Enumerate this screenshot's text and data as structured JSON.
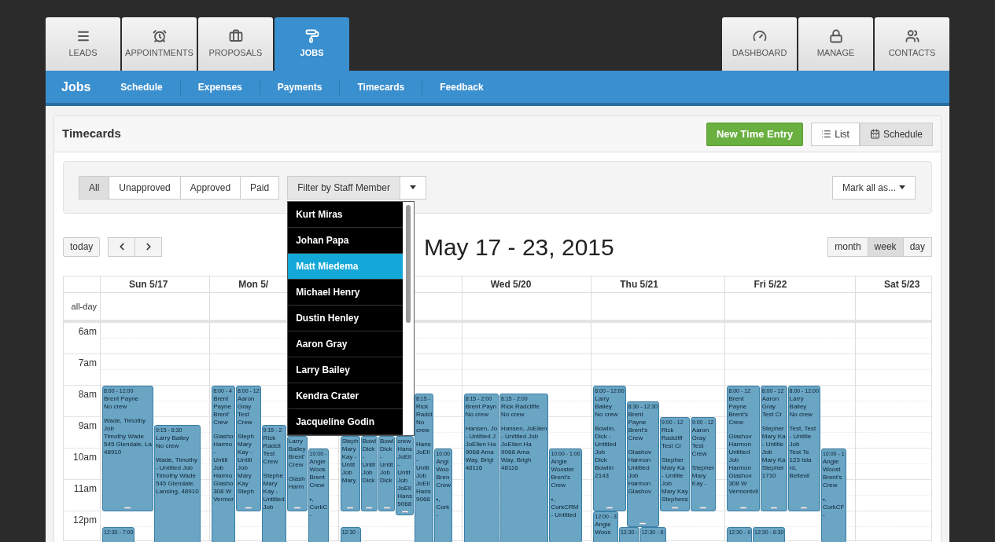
{
  "tabs_left": [
    {
      "label": "LEADS",
      "selected": false
    },
    {
      "label": "APPOINTMENTS",
      "selected": false
    },
    {
      "label": "PROPOSALS",
      "selected": false
    },
    {
      "label": "JOBS",
      "selected": true
    }
  ],
  "tabs_right": [
    {
      "label": "DASHBOARD",
      "selected": false
    },
    {
      "label": "MANAGE",
      "selected": false
    },
    {
      "label": "CONTACTS",
      "selected": false
    }
  ],
  "subnav": {
    "title": "Jobs",
    "links": [
      "Schedule",
      "Expenses",
      "Payments",
      "Timecards",
      "Feedback"
    ]
  },
  "panel": {
    "title": "Timecards",
    "new_button": "New Time Entry",
    "views": [
      {
        "label": "List",
        "selected": false
      },
      {
        "label": "Schedule",
        "selected": true
      }
    ]
  },
  "filters": {
    "status": [
      {
        "label": "All",
        "selected": true
      },
      {
        "label": "Unapproved",
        "selected": false
      },
      {
        "label": "Approved",
        "selected": false
      },
      {
        "label": "Paid",
        "selected": false
      }
    ],
    "staff_filter": "Filter by Staff Member",
    "mark_all": "Mark all as...",
    "staff_menu": [
      {
        "label": "Kurt Miras",
        "selected": false
      },
      {
        "label": "Johan Papa",
        "selected": false
      },
      {
        "label": "Matt Miedema",
        "selected": true
      },
      {
        "label": "Michael Henry",
        "selected": false
      },
      {
        "label": "Dustin Henley",
        "selected": false
      },
      {
        "label": "Aaron Gray",
        "selected": false
      },
      {
        "label": "Larry Bailey",
        "selected": false
      },
      {
        "label": "Kendra Crater",
        "selected": false
      },
      {
        "label": "Jacqueline Godin",
        "selected": false
      }
    ]
  },
  "calendar": {
    "today": "today",
    "title": "May 17 - 23, 2015",
    "ranges": [
      {
        "label": "month",
        "selected": false
      },
      {
        "label": "week",
        "selected": true
      },
      {
        "label": "day",
        "selected": false
      }
    ],
    "all_day": "all-day",
    "hours": [
      "6am",
      "7am",
      "8am",
      "9am",
      "10am",
      "11am",
      "12pm"
    ],
    "days": [
      {
        "label": "Sun 5/17",
        "groups": [
          {
            "events": [
              {
                "time": "8:00 - 12:00",
                "head": [
                  "Brent Payne",
                  "No crew"
                ],
                "body": [
                  "Wade, Timothy",
                  "Job",
                  "Timothy Wade",
                  "545 Glendale, La",
                  "48910"
                ]
              },
              {
                "time": "9:15 - 6:30",
                "head": [
                  "Larry Bailey",
                  "No crew"
                ],
                "body": [
                  "Wade, Timothy",
                  "- Untitled Job",
                  "Timothy Wade",
                  "545 Glendale,",
                  "Lansing, 48910"
                ]
              }
            ]
          },
          {
            "events": [
              {
                "time": "12:30 - 7:00"
              }
            ]
          }
        ]
      },
      {
        "label": "Mon 5/",
        "groups": [
          {
            "events": [
              {
                "time": "8:00 - 4",
                "head": [
                  "Brent",
                  "Payne",
                  "Brent'",
                  "Crew"
                ],
                "body": [
                  "Glasho",
                  "Harmo",
                  "-",
                  "Untitl",
                  "Job",
                  "Harmo",
                  "Glasho",
                  "308 W",
                  "Vermor"
                ]
              },
              {
                "time": "8:00 - 12",
                "head": [
                  "Aaron",
                  "Gray",
                  "Test",
                  "Crew"
                ],
                "body": [
                  "Steph",
                  "Mary",
                  "Kay -",
                  "Untitl",
                  "Job",
                  "Mary",
                  "Kay",
                  "Steph"
                ]
              },
              {
                "time": "9:15 - 2",
                "head": [
                  "Rick",
                  "Radcli",
                  "Test",
                  "Crew"
                ],
                "body": [
                  "Stephe",
                  "Mary",
                  "Kay -",
                  "Untitled",
                  "Job"
                ]
              },
              {
                "head": [
                  "Larry",
                  "Bailey",
                  "Brent'",
                  "Crew"
                ],
                "body": [
                  "Glash",
                  "Harm"
                ]
              },
              {
                "time": "10:00 -",
                "head": [
                  "Angie",
                  "Woos",
                  "Brent",
                  "Crew"
                ],
                "body": [
                  "•,",
                  "CorkC",
                  "-"
                ]
              }
            ]
          }
        ]
      },
      {
        "groups": [
          {
            "events": [
              {
                "body": [
                  "Steph",
                  "Mary",
                  "Kay -",
                  "Untit",
                  "Job",
                  "Mary"
                ]
              },
              {
                "body": [
                  "Bowl",
                  "Dick",
                  "-",
                  "Untit",
                  "Job",
                  "Dick"
                ]
              },
              {
                "body": [
                  "Bowl",
                  "Dick",
                  "-",
                  "Untit",
                  "Job",
                  "Dick"
                ]
              },
              {
                "body": [
                  "crew",
                  "Hans",
                  "JoEll",
                  "-",
                  "Untit",
                  "Job",
                  "JoEll",
                  "Hans",
                  "9068"
                ]
              },
              {
                "time": "8:15 -",
                "head": [
                  "Rick",
                  "Radcl",
                  "No",
                  "crew"
                ],
                "body": [
                  "Hans",
                  "JoEll",
                  "-",
                  "Untit",
                  "Job",
                  "JoEll",
                  "Hans",
                  "9068"
                ]
              },
              {
                "time": "10:00",
                "head": [
                  "Angi",
                  "Woo",
                  "Bren",
                  "Crew"
                ],
                "body": [
                  "•,",
                  "Cork",
                  "-"
                ]
              }
            ]
          },
          {
            "events": [
              {
                "time": "12:30 -"
              }
            ]
          }
        ]
      },
      {
        "label": "Wed 5/20",
        "groups": [
          {
            "events": [
              {
                "time": "8:15 - 2:00",
                "head": [
                  "Brent Payn",
                  "No crew"
                ],
                "body": [
                  "Hansen, Jo",
                  "- Untitled J",
                  "JoEllen Ha",
                  "9068 Ama",
                  "Way, Brigl",
                  "48116"
                ]
              },
              {
                "time": "8:15 - 2:00",
                "head": [
                  "Rick Radcliffe",
                  "No crew"
                ],
                "body": [
                  "Hansen, JoEllen",
                  "- Untitled Job",
                  "JoEllen Ha",
                  "9068 Ama",
                  "Way, Brigh",
                  "48116"
                ]
              },
              {
                "time": "10:00 - 1:00",
                "head": [
                  "Angie",
                  "Wooster",
                  "Brent's",
                  "Crew"
                ],
                "body": [
                  "•,",
                  "CorkCRM",
                  "- Untitled"
                ]
              }
            ]
          }
        ]
      },
      {
        "label": "Thu 5/21",
        "groups": [
          {
            "events": [
              {
                "time": "8:00 - 12:00",
                "head": [
                  "Larry",
                  "Bailey",
                  "No crew"
                ],
                "body": [
                  "Bowlin,",
                  "Dick -",
                  "Untitled",
                  "Job",
                  "Dick",
                  "Bowlin",
                  "2143"
                ]
              },
              {
                "time": "8:30 - 12:30",
                "head": [
                  "Brent",
                  "Payne",
                  "Brent's",
                  "Crew"
                ],
                "body": [
                  "Glashov",
                  "Harmon",
                  "Untitled",
                  "Job",
                  "Harmon",
                  "Glashov"
                ]
              },
              {
                "time": "9:00 - 12",
                "head": [
                  "Rick",
                  "Radcliff",
                  "Test Cr"
                ],
                "body": [
                  "Stepher",
                  "Mary Ka",
                  "- Untitle",
                  "Job",
                  "Mary Kay",
                  "Stephens"
                ]
              },
              {
                "time": "9:00 - 12",
                "head": [
                  "Aaron",
                  "Gray",
                  "Test",
                  "Crew"
                ],
                "body": [
                  "Stepher",
                  "Mary",
                  "Kay -"
                ]
              }
            ]
          },
          {
            "events": [
              {
                "time": "12:00 - 3",
                "head": [
                  "Angie",
                  "Woos"
                ]
              },
              {
                "time": "12:30 -"
              },
              {
                "time": "12:30 - 6:"
              }
            ]
          }
        ]
      },
      {
        "label": "Fri 5/22",
        "groups": [
          {
            "events": [
              {
                "time": "8:00 - 12",
                "head": [
                  "Brent",
                  "Payne",
                  "Brent's",
                  "Crew"
                ],
                "body": [
                  "Glashov",
                  "Harmon",
                  "Untitled",
                  "Job",
                  "Harmon",
                  "Glashov",
                  "308 W",
                  "Vermontvil"
                ]
              },
              {
                "time": "8:00 - 12",
                "head": [
                  "Aaron",
                  "Gray",
                  "Test Cr"
                ],
                "body": [
                  "Stepher",
                  "Mary Ka",
                  "- Untitle",
                  "Job",
                  "Mary Ka",
                  "Stepher",
                  "1710"
                ]
              },
              {
                "time": "8:00 - 12:00",
                "head": [
                  "Larry",
                  "Bailey",
                  "No crew"
                ],
                "body": [
                  "Test, Test",
                  "- Untitle",
                  "Job",
                  "Test Te",
                  "123 Isla",
                  "rd,",
                  "Bellevil"
                ]
              },
              {
                "time": "10:00 - 1",
                "head": [
                  "Angie",
                  "Woost",
                  "Brent's",
                  "Crew"
                ],
                "body": [
                  "•,",
                  "CorkCF",
                  "-"
                ]
              }
            ]
          },
          {
            "events": [
              {
                "time": "12:30 - 9"
              },
              {
                "time": "12:30 - 6:30"
              }
            ]
          }
        ]
      },
      {
        "label": "Sat 5/23"
      }
    ]
  }
}
